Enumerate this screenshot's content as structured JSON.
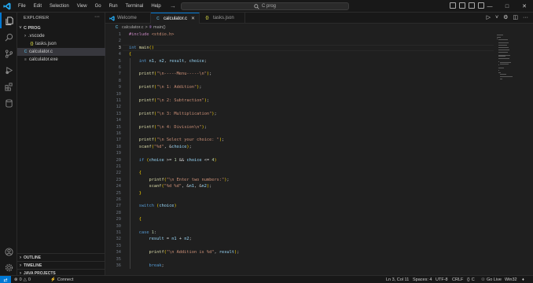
{
  "window": {
    "menu": [
      "File",
      "Edit",
      "Selection",
      "View",
      "Go",
      "Run",
      "Terminal",
      "Help"
    ],
    "search_text": "C prog"
  },
  "explorer": {
    "title": "EXPLORER",
    "root": "C PROG",
    "items": [
      {
        "label": ".vscode",
        "kind": "folder"
      },
      {
        "label": "tasks.json",
        "kind": "json"
      },
      {
        "label": "calculator.c",
        "kind": "c"
      },
      {
        "label": "calculator.exe",
        "kind": "exe"
      }
    ],
    "sections": [
      "OUTLINE",
      "TIMELINE",
      "JAVA PROJECTS"
    ]
  },
  "tabs": [
    {
      "label": "Welcome",
      "kind": "vscode"
    },
    {
      "label": "calculator.c",
      "kind": "c"
    },
    {
      "label": "tasks.json",
      "kind": "json"
    }
  ],
  "breadcrumb": {
    "file": "calculator.c",
    "sep": ">",
    "symbol": "main()"
  },
  "code": {
    "line_numbers": [
      "1",
      "2",
      "3",
      "4",
      "5",
      "6",
      "7",
      "8",
      "9",
      "10",
      "11",
      "12",
      "13",
      "14",
      "15",
      "16",
      "17",
      "18",
      "19",
      "20",
      "21",
      "22",
      "23",
      "24",
      "25",
      "26",
      "27",
      "28",
      "29",
      "30",
      "31",
      "32",
      "33",
      "34",
      "35",
      "36"
    ],
    "lines": [
      "#include <stdio.h>",
      "",
      "int main()",
      "{",
      "    int n1, n2, result, choice;",
      "",
      "    printf(\"\\n-----Menu-----\\n\");",
      "",
      "    printf(\"\\n 1: Addition\");",
      "",
      "    printf(\"\\n 2: Subtraction\");",
      "",
      "    printf(\"\\n 3: Multiplication\");",
      "",
      "    printf(\"\\n 4: Division\\n\");",
      "",
      "    printf(\"\\n Select your choice: \");",
      "    scanf(\"%d\", &choice);",
      "",
      "    if (choice >= 1 && choice <= 4)",
      "",
      "    {",
      "        printf(\"\\n Enter two numbers:\");",
      "        scanf(\"%d %d\", &n1, &n2);",
      "    }",
      "",
      "    switch (choice)",
      "",
      "    {",
      "",
      "    case 1:",
      "        result = n1 + n2;",
      "",
      "        printf(\"\\n Addition is %d\", result);",
      "",
      "        break;"
    ]
  },
  "status": {
    "errors": "0",
    "warnings": "0",
    "connect": "Connect",
    "position": "Ln 3, Col 11",
    "spaces": "Spaces: 4",
    "encoding": "UTF-8",
    "eol": "CRLF",
    "braces": "{}",
    "language": "C",
    "golive": "Go Live",
    "platform": "Win32"
  },
  "colors": {
    "accent": "#0078d4",
    "background": "#1f1f1f",
    "chrome": "#181818",
    "keyword": "#569cd6",
    "string": "#ce9178",
    "function": "#dcdcaa",
    "variable": "#9cdcfe",
    "number": "#b5cea8",
    "preprocessor": "#c586c0"
  }
}
